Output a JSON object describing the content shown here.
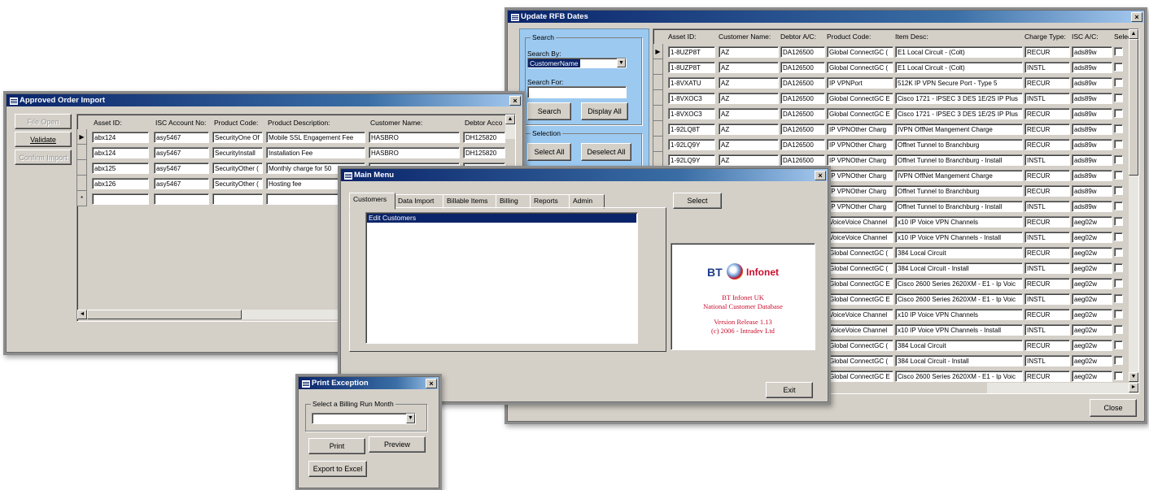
{
  "update_rfb": {
    "title": "Update RFB Dates",
    "search_group": "Search",
    "search_by_label": "Search By:",
    "search_by_value": "CustomerName",
    "search_for_label": "Search For:",
    "search_button": "Search",
    "display_all_button": "Display All",
    "selection_group": "Selection",
    "select_all_button": "Select All",
    "deselect_all_button": "Deselect All",
    "close_button": "Close",
    "columns": [
      "Asset ID:",
      "Customer Name:",
      "Debtor A/C:",
      "Product Code:",
      "Item Desc:",
      "Charge Type:",
      "ISC A/C:",
      "Select:"
    ],
    "rows": [
      [
        "1-8UZP8T",
        "AZ",
        "DA126500",
        "Global ConnectGC (",
        "E1 Local Circuit - (Colt)",
        "RECUR",
        "ads89w"
      ],
      [
        "1-8UZP8T",
        "AZ",
        "DA126500",
        "Global ConnectGC (",
        "E1 Local Circuit - (Colt)",
        "INSTL",
        "ads89w"
      ],
      [
        "1-8VXATU",
        "AZ",
        "DA126500",
        "IP VPNPort",
        "512K IP VPN Secure Port - Type 5",
        "RECUR",
        "ads89w"
      ],
      [
        "1-8VXOC3",
        "AZ",
        "DA126500",
        "Global ConnectGC E",
        "Cisco 1721 - IPSEC 3 DES 1E/2S IP Plus",
        "INSTL",
        "ads89w"
      ],
      [
        "1-8VXOC3",
        "AZ",
        "DA126500",
        "Global ConnectGC E",
        "Cisco 1721 - IPSEC 3 DES 1E/2S IP Plus",
        "RECUR",
        "ads89w"
      ],
      [
        "1-92LQ8T",
        "AZ",
        "DA126500",
        "IP VPNOther Charg",
        "IVPN OffNet Mangement Charge",
        "RECUR",
        "ads89w"
      ],
      [
        "1-92LQ9Y",
        "AZ",
        "DA126500",
        "IP VPNOther Charg",
        "Offnet Tunnel to Branchburg",
        "RECUR",
        "ads89w"
      ],
      [
        "1-92LQ9Y",
        "AZ",
        "DA126500",
        "IP VPNOther Charg",
        "Offnet Tunnel to Branchburg - Install",
        "INSTL",
        "ads89w"
      ],
      [
        "",
        "",
        "",
        "IP VPNOther Charg",
        "IVPN OffNet Mangement Charge",
        "RECUR",
        "ads89w"
      ],
      [
        "",
        "",
        "",
        "IP VPNOther Charg",
        "Offnet Tunnel to Branchburg",
        "RECUR",
        "ads89w"
      ],
      [
        "",
        "",
        "",
        "IP VPNOther Charg",
        "Offnet Tunnel to Branchburg - Install",
        "INSTL",
        "ads89w"
      ],
      [
        "",
        "",
        "",
        "VoiceVoice Channel",
        "x10 IP Voice VPN Channels",
        "RECUR",
        "aeg02w"
      ],
      [
        "",
        "",
        "",
        "VoiceVoice Channel",
        "x10 IP Voice VPN Channels - Install",
        "INSTL",
        "aeg02w"
      ],
      [
        "",
        "",
        "",
        "Global ConnectGC (",
        "384 Local Circuit",
        "RECUR",
        "aeg02w"
      ],
      [
        "",
        "",
        "",
        "Global ConnectGC (",
        "384 Local Circuit - Install",
        "INSTL",
        "aeg02w"
      ],
      [
        "",
        "",
        "",
        "Global ConnectGC E",
        "Cisco 2600 Series 2620XM - E1 - Ip Voic",
        "RECUR",
        "aeg02w"
      ],
      [
        "",
        "",
        "",
        "Global ConnectGC E",
        "Cisco 2600 Series 2620XM - E1 - Ip Voic",
        "INSTL",
        "aeg02w"
      ],
      [
        "",
        "",
        "",
        "VoiceVoice Channel",
        "x10 IP Voice VPN Channels",
        "RECUR",
        "aeg02w"
      ],
      [
        "",
        "",
        "",
        "VoiceVoice Channel",
        "x10 IP Voice VPN Channels - Install",
        "INSTL",
        "aeg02w"
      ],
      [
        "",
        "",
        "",
        "Global ConnectGC (",
        "384 Local Circuit",
        "RECUR",
        "aeg02w"
      ],
      [
        "",
        "",
        "",
        "Global ConnectGC (",
        "384 Local Circuit - Install",
        "INSTL",
        "aeg02w"
      ],
      [
        "",
        "",
        "",
        "Global ConnectGC E",
        "Cisco 2600 Series 2620XM - E1 - Ip Voic",
        "RECUR",
        "aeg02w"
      ]
    ]
  },
  "approved_order": {
    "title": "Approved Order Import",
    "file_open_button": "File Open",
    "validate_button": "Validate",
    "confirm_import_button": "Confirm Import",
    "columns": [
      "Asset ID:",
      "ISC Account No:",
      "Product Code:",
      "Product Description:",
      "Customer Name:",
      "Debtor Acco"
    ],
    "rows": [
      [
        "abx124",
        "asy5467",
        "SecurityOne Of",
        "Mobile SSL Engagement Fee",
        "HASBRO",
        "DH125820"
      ],
      [
        "abx124",
        "asy5467",
        "SecurityInstall",
        "Installation Fee",
        "HASBRO",
        "DH125820"
      ],
      [
        "abx125",
        "asy5467",
        "SecurityOther (",
        "Monthly charge for 50",
        "",
        ""
      ],
      [
        "abx126",
        "asy5467",
        "SecurityOther (",
        "Hosting fee",
        "",
        ""
      ]
    ]
  },
  "main_menu": {
    "title": "Main Menu",
    "tabs": [
      "Customers",
      "Data Import",
      "Billable Items",
      "Billing",
      "Reports",
      "Admin"
    ],
    "list_items": [
      "Edit Customers"
    ],
    "select_button": "Select",
    "exit_button": "Exit",
    "logo_bt": "BT",
    "logo_infonet": "Infonet",
    "info_line1": "BT Infonet UK",
    "info_line2": "National Customer Database",
    "info_version": "Version Release 1.13",
    "info_copyright": "(c)  2006 - Intradev Ltd"
  },
  "print_exception": {
    "title": "Print Exception",
    "group_label": "Select a Billing Run Month",
    "dropdown_value": "",
    "print_button": "Print",
    "preview_button": "Preview",
    "export_button": "Export to Excel"
  },
  "colors": {
    "titlebar": "#0a246a",
    "face": "#d4d0c8",
    "logo_red": "#c8102e",
    "logo_blue": "#1f3c88",
    "search_panel": "#9cc9f0"
  }
}
